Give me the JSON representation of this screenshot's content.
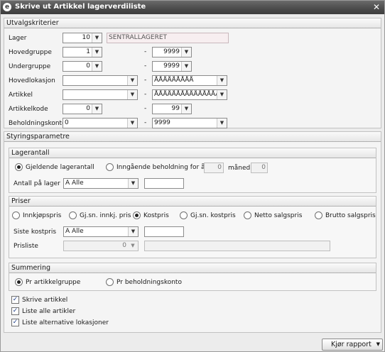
{
  "window": {
    "title": "Skrive ut Artikkel lagerverdiliste",
    "app_icon": "app-logo-icon",
    "close_glyph": "✕"
  },
  "utvalg": {
    "header": "Utvalgskriterier",
    "lager": {
      "label": "Lager",
      "value": "10",
      "name": "SENTRALLAGERET"
    },
    "hovedgruppe": {
      "label": "Hovedgruppe",
      "from": "1",
      "to": "9999"
    },
    "undergruppe": {
      "label": "Undergruppe",
      "from": "0",
      "to": "9999"
    },
    "hovedlokasjon": {
      "label": "Hovedlokasjon",
      "from": "",
      "to": "ÅÅÅÅÅÅÅÅÅ"
    },
    "artikkel": {
      "label": "Artikkel",
      "from": "",
      "to": "ÅÅÅÅÅÅÅÅÅÅÅÅÅÅÅÅ"
    },
    "artikkelkode": {
      "label": "Artikkelkode",
      "from": "0",
      "to": "99"
    },
    "beholdningskonto": {
      "label": "Beholdningskonto",
      "from": "0",
      "to": "9999"
    },
    "range_separator": "-"
  },
  "styring": {
    "header": "Styringsparametre",
    "lagerantall": {
      "header": "Lagerantall",
      "option_gjeldende": "Gjeldende lagerantall",
      "option_inngaende": "Inngående beholdning for år",
      "year": "0",
      "month_label": "måned",
      "month": "0",
      "antall_label": "Antall på lager",
      "antall_value": "A Alle",
      "antall_extra": ""
    },
    "priser": {
      "header": "Priser",
      "options": [
        "Innkjøpspris",
        "Gj.sn. innkj. pris",
        "Kostpris",
        "Gj.sn. kostpris",
        "Netto salgspris",
        "Brutto salgspris"
      ],
      "selected": "Kostpris",
      "siste_label": "Siste kostpris",
      "siste_value": "A Alle",
      "siste_extra": "",
      "prisliste_label": "Prisliste",
      "prisliste_value": "0",
      "prisliste_name": ""
    },
    "summering": {
      "header": "Summering",
      "option_gruppe": "Pr artikkelgruppe",
      "option_konto": "Pr beholdningskonto",
      "selected": "Pr artikkelgruppe"
    },
    "checks": [
      {
        "label": "Skrive artikkel",
        "checked": true
      },
      {
        "label": "Liste alle artikler",
        "checked": true
      },
      {
        "label": "Liste alternative lokasjoner",
        "checked": true
      }
    ]
  },
  "footer": {
    "run_button": "Kjør rapport"
  },
  "icons": {
    "dropdown": "chevron-down-icon",
    "close": "close-icon",
    "check": "checkmark-icon"
  }
}
